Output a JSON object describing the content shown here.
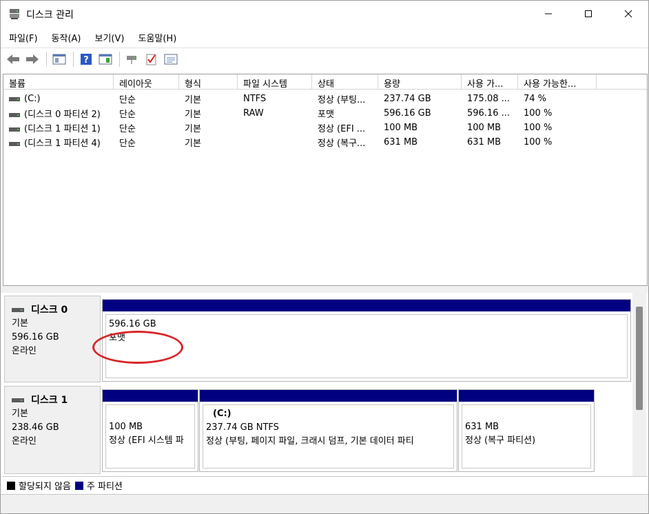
{
  "window": {
    "title": "디스크 관리",
    "icon": "disk-management-icon"
  },
  "menu": [
    {
      "label": "파일(F)"
    },
    {
      "label": "동작(A)"
    },
    {
      "label": "보기(V)"
    },
    {
      "label": "도움말(H)"
    }
  ],
  "toolbar": [
    {
      "icon": "back-arrow-icon"
    },
    {
      "icon": "forward-arrow-icon"
    },
    {
      "icon": "console-tree-icon"
    },
    {
      "icon": "help-icon"
    },
    {
      "icon": "properties-icon"
    },
    {
      "icon": "connect-disk-icon"
    },
    {
      "icon": "check-disk-icon"
    },
    {
      "icon": "volume-list-icon"
    }
  ],
  "volume_list": {
    "columns": [
      "볼륨",
      "레이아웃",
      "형식",
      "파일 시스템",
      "상태",
      "용량",
      "사용 가...",
      "사용 가능한..."
    ],
    "rows": [
      [
        "(C:)",
        "단순",
        "기본",
        "NTFS",
        "정상 (부팅...",
        "237.74 GB",
        "175.08 ...",
        "74 %"
      ],
      [
        "(디스크 0 파티션 2)",
        "단순",
        "기본",
        "RAW",
        "포맷",
        "596.16 GB",
        "596.16 ...",
        "100 %"
      ],
      [
        "(디스크 1 파티션 1)",
        "단순",
        "기본",
        "",
        "정상 (EFI ...",
        "100 MB",
        "100 MB",
        "100 %"
      ],
      [
        "(디스크 1 파티션 4)",
        "단순",
        "기본",
        "",
        "정상 (복구...",
        "631 MB",
        "631 MB",
        "100 %"
      ]
    ]
  },
  "disks": [
    {
      "name": "디스크 0",
      "type": "기본",
      "size": "596.16 GB",
      "status": "온라인",
      "partitions": [
        {
          "title": "",
          "line1": "596.16 GB",
          "line2": "포맷"
        }
      ]
    },
    {
      "name": "디스크 1",
      "type": "기본",
      "size": "238.46 GB",
      "status": "온라인",
      "partitions": [
        {
          "title": "",
          "line1": "100 MB",
          "line2": "정상 (EFI 시스템 파"
        },
        {
          "title": "(C:)",
          "line1": "237.74 GB NTFS",
          "line2": "정상 (부팅, 페이지 파일, 크래시 덤프, 기본 데이터 파티"
        },
        {
          "title": "",
          "line1": "631 MB",
          "line2": "정상 (복구 파티션)"
        }
      ]
    }
  ],
  "legend": [
    {
      "label": "할당되지 않음",
      "color": "#000000"
    },
    {
      "label": "주 파티션",
      "color": "#000080"
    }
  ],
  "colors": {
    "primary_partition": "#000080",
    "highlight_ring": "#d9262a"
  }
}
